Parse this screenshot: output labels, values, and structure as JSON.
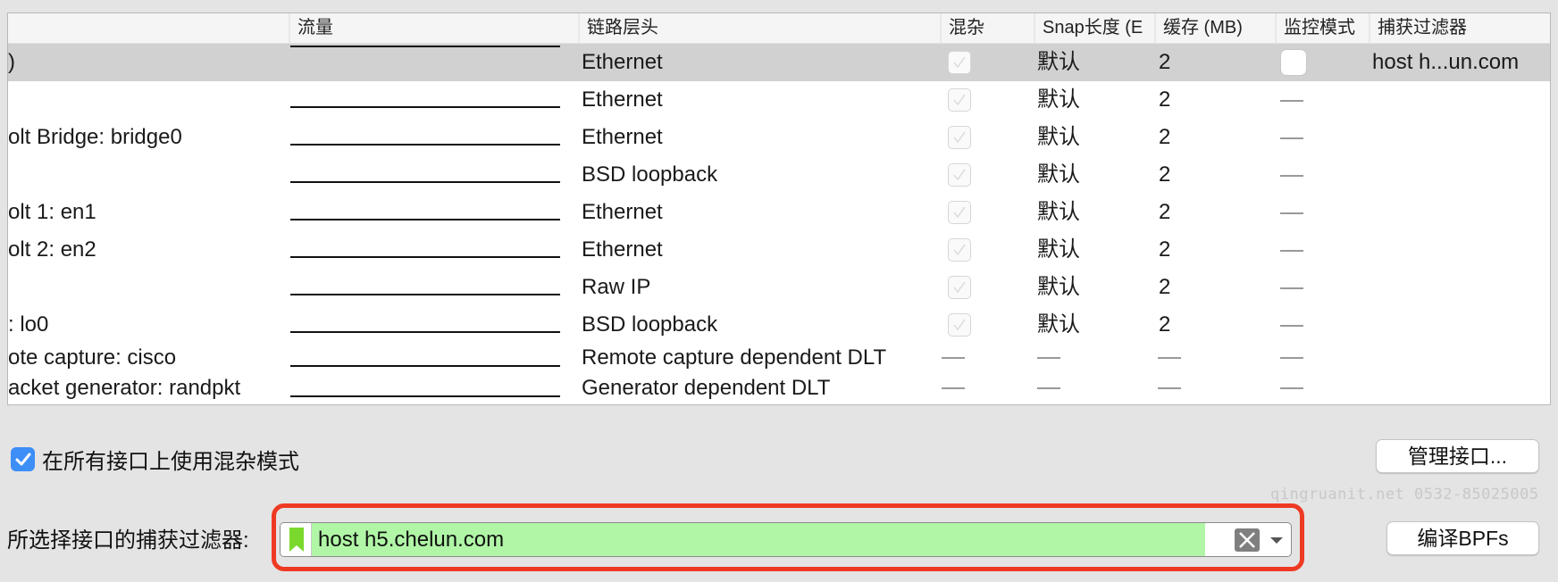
{
  "table": {
    "columns": [
      {
        "key": "interface",
        "label": ""
      },
      {
        "key": "traffic",
        "label": "流量"
      },
      {
        "key": "link_layer",
        "label": "链路层头"
      },
      {
        "key": "promisc",
        "label": "混杂"
      },
      {
        "key": "snaplen",
        "label": "Snap长度 (E"
      },
      {
        "key": "buffer",
        "label": "缓存 (MB)"
      },
      {
        "key": "monitor",
        "label": "监控模式"
      },
      {
        "key": "capture_filter",
        "label": "捕获过滤器"
      }
    ],
    "rows": [
      {
        "interface": ")",
        "link_layer": "Ethernet",
        "promisc": "checked-disabled",
        "snaplen": "默认",
        "buffer": "2",
        "monitor": "checkbox",
        "capture_filter": "host h...un.com",
        "selected": true
      },
      {
        "interface": "",
        "link_layer": "Ethernet",
        "promisc": "checked-disabled",
        "snaplen": "默认",
        "buffer": "2",
        "monitor": "—",
        "capture_filter": ""
      },
      {
        "interface": "olt Bridge: bridge0",
        "link_layer": "Ethernet",
        "promisc": "checked-disabled",
        "snaplen": "默认",
        "buffer": "2",
        "monitor": "—",
        "capture_filter": ""
      },
      {
        "interface": "",
        "link_layer": "BSD loopback",
        "promisc": "checked-disabled",
        "snaplen": "默认",
        "buffer": "2",
        "monitor": "—",
        "capture_filter": ""
      },
      {
        "interface": "olt 1: en1",
        "link_layer": "Ethernet",
        "promisc": "checked-disabled",
        "snaplen": "默认",
        "buffer": "2",
        "monitor": "—",
        "capture_filter": ""
      },
      {
        "interface": "olt 2: en2",
        "link_layer": "Ethernet",
        "promisc": "checked-disabled",
        "snaplen": "默认",
        "buffer": "2",
        "monitor": "—",
        "capture_filter": ""
      },
      {
        "interface": "",
        "link_layer": "Raw IP",
        "promisc": "checked-disabled",
        "snaplen": "默认",
        "buffer": "2",
        "monitor": "—",
        "capture_filter": ""
      },
      {
        "interface": ": lo0",
        "link_layer": "BSD loopback",
        "promisc": "checked-disabled",
        "snaplen": "默认",
        "buffer": "2",
        "monitor": "—",
        "capture_filter": ""
      },
      {
        "interface": "ote capture: cisco",
        "link_layer": "Remote capture dependent DLT",
        "promisc": "—",
        "snaplen": "—",
        "buffer": "—",
        "monitor": "—",
        "capture_filter": ""
      },
      {
        "interface": "acket generator: randpkt",
        "link_layer": "Generator dependent DLT",
        "promisc": "—",
        "snaplen": "—",
        "buffer": "—",
        "monitor": "—",
        "capture_filter": ""
      }
    ]
  },
  "promisc_all": {
    "label": "在所有接口上使用混杂模式",
    "checked": true
  },
  "buttons": {
    "manage_interfaces": "管理接口...",
    "compile_bpfs": "编译BPFs"
  },
  "capture_filter": {
    "label": "所选择接口的捕获过滤器:",
    "value": "host h5.chelun.com",
    "valid_color": "#b0f6a6"
  },
  "annotation": {
    "highlight_color": "#ef3a23"
  },
  "watermark": "qingruanit.net 0532-85025005"
}
